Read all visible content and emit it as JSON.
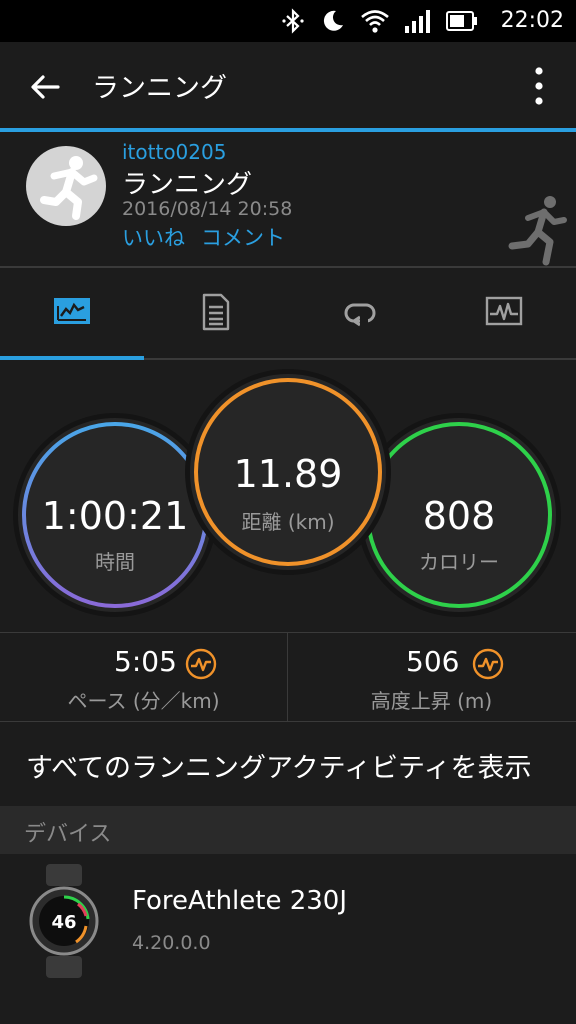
{
  "status_bar": {
    "time": "22:02",
    "icons": [
      "bluetooth-icon",
      "moon-icon",
      "wifi-icon",
      "signal-icon",
      "battery-icon"
    ]
  },
  "app_bar": {
    "title": "ランニング"
  },
  "activity": {
    "user": "itotto0205",
    "title": "ランニング",
    "datetime": "2016/08/14 20:58",
    "like_label": "いいね",
    "comment_label": "コメント"
  },
  "tabs": [
    {
      "icon": "overview-icon",
      "active": true
    },
    {
      "icon": "details-icon",
      "active": false
    },
    {
      "icon": "laps-icon",
      "active": false
    },
    {
      "icon": "chart-icon",
      "active": false
    }
  ],
  "metrics": {
    "time": {
      "value": "1:00:21",
      "label": "時間",
      "color": "#4aa6e8"
    },
    "distance": {
      "value": "11.89",
      "label": "距離",
      "unit": "(km)",
      "color": "#f0922a"
    },
    "calories": {
      "value": "808",
      "label": "カロリー",
      "color": "#2ed14a"
    }
  },
  "stats": {
    "pace": {
      "value": "5:05",
      "label": "ペース (分／km)"
    },
    "elevation": {
      "value": "506",
      "label": "高度上昇 (m)"
    }
  },
  "all_activities_label": "すべてのランニングアクティビティを表示",
  "devices_section_label": "デバイス",
  "device": {
    "name": "ForeAthlete 230J",
    "version": "4.20.0.0",
    "screen_value": "46"
  },
  "colors": {
    "accent": "#2a9fe0",
    "background": "#1c1c1c"
  }
}
